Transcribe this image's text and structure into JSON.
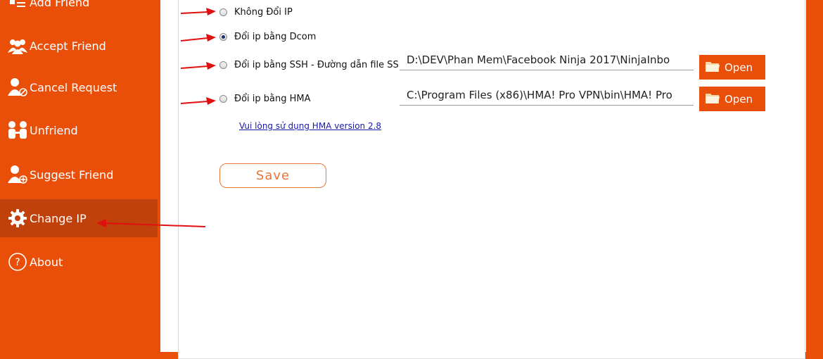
{
  "sidebar": {
    "items": [
      {
        "label": "Add Friend",
        "icon": "add-friend-icon"
      },
      {
        "label": "Accept Friend",
        "icon": "users-icon"
      },
      {
        "label": "Cancel Request",
        "icon": "user-cancel-icon"
      },
      {
        "label": "Unfriend",
        "icon": "unfriend-icon"
      },
      {
        "label": "Suggest Friend",
        "icon": "user-add-icon"
      },
      {
        "label": "Change IP",
        "icon": "gear-icon",
        "active": true
      },
      {
        "label": "About",
        "icon": "question-icon"
      }
    ]
  },
  "options": [
    {
      "label": "Không Đổi IP",
      "checked": false
    },
    {
      "label": "Đổi ip bằng Dcom",
      "checked": true
    },
    {
      "label": "Đổi ip bằng SSH - Đường dẫn file SSH",
      "checked": false
    },
    {
      "label": "Đổi ip bằng HMA",
      "checked": false
    }
  ],
  "ssh_path": {
    "value": "D:\\DEV\\Phan Mem\\Facebook Ninja 2017\\NinjaInbo"
  },
  "hma_path": {
    "value": "C:\\Program Files (x86)\\HMA! Pro VPN\\bin\\HMA! Pro"
  },
  "open_label": "Open",
  "hma_note": "Vui lòng sử dụng HMA version 2.8",
  "save_label": "Save",
  "colors": {
    "accent": "#ea4f0a",
    "active": "#c0410b",
    "arrow": "#e01010"
  }
}
